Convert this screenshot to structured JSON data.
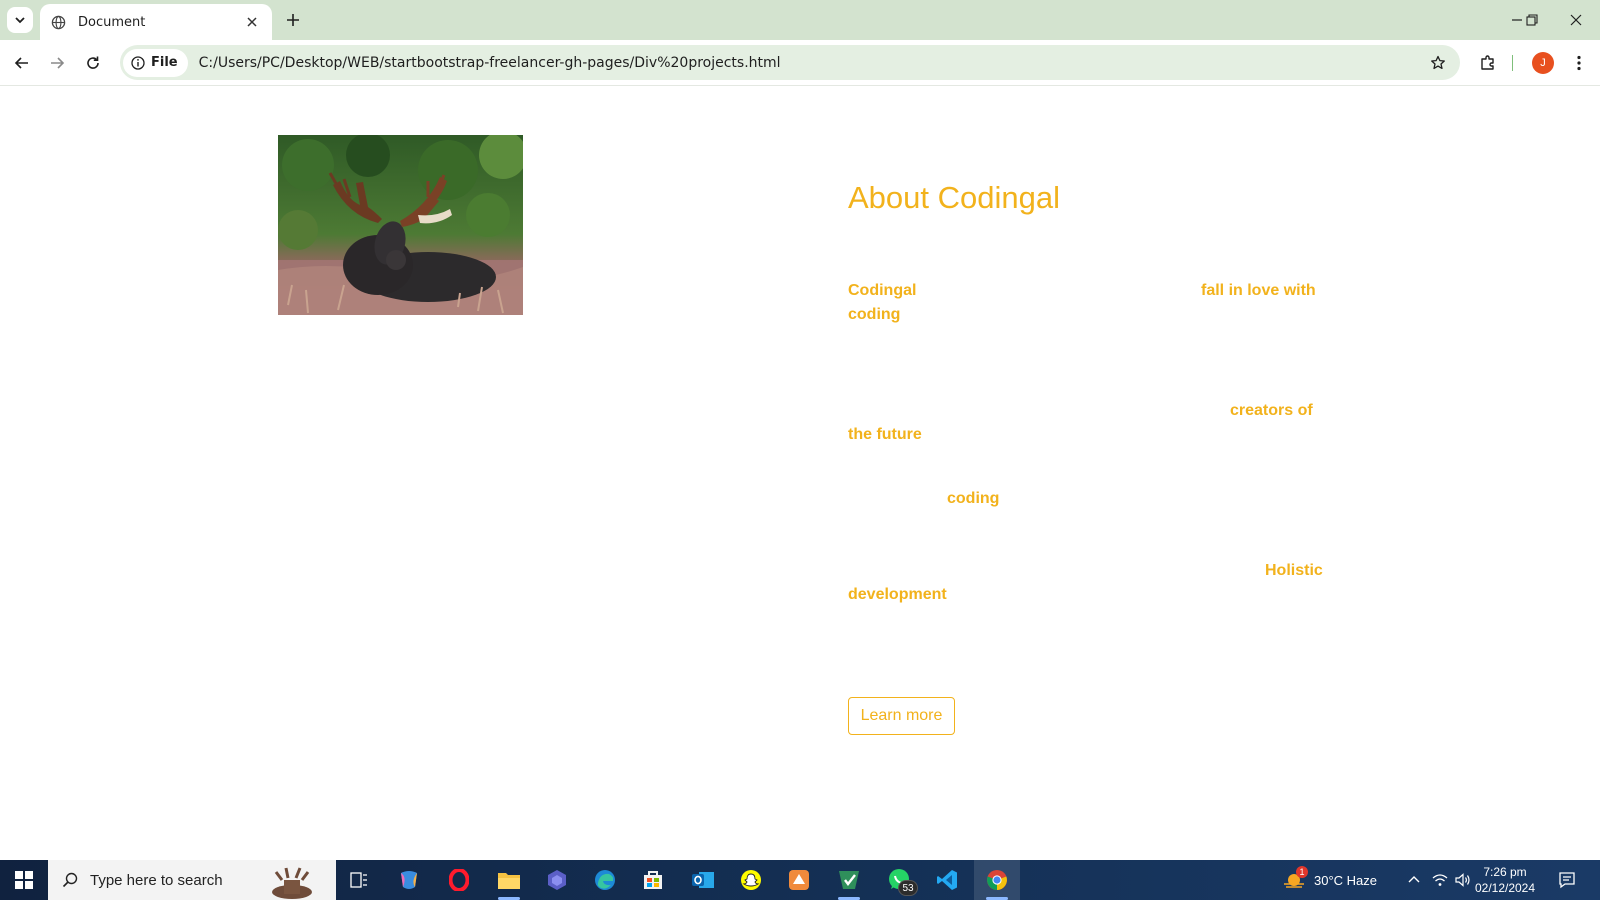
{
  "browser": {
    "tab": {
      "title": "Document"
    },
    "address": {
      "chip_label": "File",
      "url": "C:/Users/PC/Desktop/WEB/startbootstrap-freelancer-gh-pages/Div%20projects.html"
    },
    "profile_initial": "J"
  },
  "page": {
    "image_description": "moose",
    "about": {
      "title": "About Codingal",
      "keywords": {
        "codingal": "Codingal",
        "fall_in_love": "fall in love with",
        "coding_1": "coding",
        "creators_of": "creators of",
        "the_future": "the future",
        "coding_2": "coding",
        "holistic": "Holistic",
        "development": "development"
      }
    },
    "learn_more_label": "Learn more"
  },
  "colors": {
    "accent": "#f2b21c",
    "tabbar": "#d3e3cf",
    "omnibox": "#e4efe2",
    "taskbar": "#143055"
  },
  "taskbar": {
    "search_placeholder": "Type here to search",
    "apps": [
      "task-view",
      "copilot",
      "opera",
      "file-explorer",
      "sway",
      "edge",
      "microsoft-store",
      "outlook",
      "snapchat",
      "app-orange",
      "app-green",
      "whatsapp",
      "vscode",
      "chrome"
    ],
    "whatsapp_badge": "53",
    "weather_badge": "1",
    "weather": "30°C  Haze",
    "time": "7:26 pm",
    "date": "02/12/2024"
  }
}
